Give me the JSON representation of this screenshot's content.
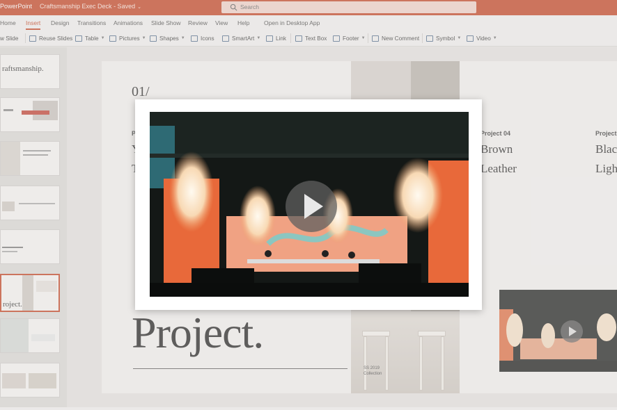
{
  "titlebar": {
    "app_name": "PowerPoint",
    "doc_title": "Craftsmanship Exec Deck",
    "doc_status": "- Saved",
    "search_placeholder": "Search"
  },
  "ribbon_tabs": [
    "Home",
    "Insert",
    "Design",
    "Transitions",
    "Animations",
    "Slide Show",
    "Review",
    "View",
    "Help",
    "Open in Desktop App"
  ],
  "ribbon_active_tab": "Insert",
  "ribbon_commands": {
    "new_slide": "w Slide",
    "reuse_slides": "Reuse Slides",
    "table": "Table",
    "pictures": "Pictures",
    "shapes": "Shapes",
    "icons": "Icons",
    "smartart": "SmartArt",
    "link": "Link",
    "text_box": "Text Box",
    "footer": "Footer",
    "new_comment": "New Comment",
    "symbol": "Symbol",
    "video": "Video"
  },
  "thumbnails": {
    "slide1_title": "raftsmanship.",
    "slide6_title": "roject."
  },
  "slide": {
    "number": "01/",
    "big_title": "Project.",
    "mid_caption_line1": "SS 2019",
    "mid_caption_line2": "Collection",
    "col1_label": "P",
    "col1_line1": "Y",
    "col1_line2": "T",
    "col2_label": "Project 04",
    "col2_line1": "Brown",
    "col2_line2": "Leather",
    "col3_label": "Project",
    "col3_line1": "Blac",
    "col3_line2": "Ligh"
  },
  "colors": {
    "accent": "#c43e1c",
    "ribbon_bg": "#f3f2f1"
  },
  "icons": {
    "play": "play-icon",
    "search": "search-icon"
  }
}
